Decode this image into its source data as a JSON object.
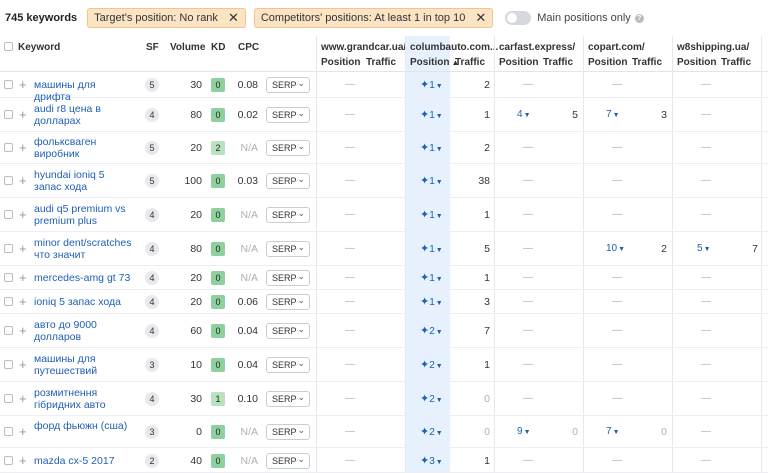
{
  "toolbar": {
    "keyword_count": "745 keywords",
    "filter_target": "Target's position: No rank",
    "filter_competitors": "Competitors' positions: At least 1 in top 10",
    "main_positions_label": "Main positions only",
    "close_glyph": "✕",
    "info_glyph": "?"
  },
  "headers": {
    "keyword": "Keyword",
    "sf": "SF",
    "volume": "Volume",
    "kd": "KD",
    "cpc": "CPC",
    "position": "Position",
    "traffic": "Traffic",
    "sort_arrow": "▲",
    "competitors": [
      "www.grandcar.ua/",
      "columbauto.com...",
      "carfast.express/",
      "copart.com/",
      "w8shipping.ua/"
    ]
  },
  "colors": {
    "kd_green": "#8fd19e",
    "kd_lightgreen": "#b9e2bf",
    "link": "#1f5fb4",
    "chip_bg": "#fbe3c4",
    "highlight_col": "#e6f1fd"
  },
  "rows": [
    {
      "kw": "машины для дрифта",
      "sf": "5",
      "vol": "30",
      "kd": "0",
      "cpc": "0.08",
      "serp": "SERP",
      "c1": "—",
      "c2_pos": "1",
      "c2_tr": "2",
      "c3_pos": "—",
      "c3_tr": "",
      "c4_pos": "—",
      "c4_tr": "",
      "c5_pos": "—",
      "c5_tr": ""
    },
    {
      "kw": "audi r8 цена в долларах",
      "sf": "4",
      "vol": "80",
      "kd": "0",
      "cpc": "0.02",
      "serp": "SERP",
      "c1": "—",
      "c2_pos": "1",
      "c2_tr": "1",
      "c3_pos": "4",
      "c3_tr": "5",
      "c4_pos": "7",
      "c4_tr": "3",
      "c5_pos": "—",
      "c5_tr": ""
    },
    {
      "kw": "фольксваген виробник",
      "sf": "5",
      "vol": "20",
      "kd": "2",
      "cpc": "N/A",
      "serp": "SERP",
      "c1": "—",
      "c2_pos": "1",
      "c2_tr": "2",
      "c3_pos": "—",
      "c3_tr": "",
      "c4_pos": "—",
      "c4_tr": "",
      "c5_pos": "—",
      "c5_tr": ""
    },
    {
      "kw": "hyundai ioniq 5 запас хода",
      "sf": "5",
      "vol": "100",
      "kd": "0",
      "cpc": "0.03",
      "serp": "SERP",
      "c1": "—",
      "c2_pos": "1",
      "c2_tr": "38",
      "c3_pos": "—",
      "c3_tr": "",
      "c4_pos": "—",
      "c4_tr": "",
      "c5_pos": "—",
      "c5_tr": ""
    },
    {
      "kw": "audi q5 premium vs premium plus",
      "sf": "4",
      "vol": "20",
      "kd": "0",
      "cpc": "N/A",
      "serp": "SERP",
      "c1": "—",
      "c2_pos": "1",
      "c2_tr": "1",
      "c3_pos": "—",
      "c3_tr": "",
      "c4_pos": "—",
      "c4_tr": "",
      "c5_pos": "—",
      "c5_tr": ""
    },
    {
      "kw": "minor dent/scratches что значит",
      "sf": "4",
      "vol": "80",
      "kd": "0",
      "cpc": "N/A",
      "serp": "SERP",
      "c1": "—",
      "c2_pos": "1",
      "c2_tr": "5",
      "c3_pos": "—",
      "c3_tr": "",
      "c4_pos": "10",
      "c4_tr": "2",
      "c5_pos": "5",
      "c5_tr": "7"
    },
    {
      "kw": "mercedes-amg gt 73",
      "sf": "4",
      "vol": "20",
      "kd": "0",
      "cpc": "N/A",
      "serp": "SERP",
      "c1": "—",
      "c2_pos": "1",
      "c2_tr": "1",
      "c3_pos": "—",
      "c3_tr": "",
      "c4_pos": "—",
      "c4_tr": "",
      "c5_pos": "—",
      "c5_tr": ""
    },
    {
      "kw": "ioniq 5 запас хода",
      "sf": "4",
      "vol": "20",
      "kd": "0",
      "cpc": "0.06",
      "serp": "SERP",
      "c1": "—",
      "c2_pos": "1",
      "c2_tr": "3",
      "c3_pos": "—",
      "c3_tr": "",
      "c4_pos": "—",
      "c4_tr": "",
      "c5_pos": "—",
      "c5_tr": ""
    },
    {
      "kw": "авто до 9000 долларов",
      "sf": "4",
      "vol": "60",
      "kd": "0",
      "cpc": "0.04",
      "serp": "SERP",
      "c1": "—",
      "c2_pos": "2",
      "c2_tr": "7",
      "c3_pos": "—",
      "c3_tr": "",
      "c4_pos": "—",
      "c4_tr": "",
      "c5_pos": "—",
      "c5_tr": ""
    },
    {
      "kw": "машины для путешествий",
      "sf": "3",
      "vol": "10",
      "kd": "0",
      "cpc": "0.04",
      "serp": "SERP",
      "c1": "—",
      "c2_pos": "2",
      "c2_tr": "1",
      "c3_pos": "—",
      "c3_tr": "",
      "c4_pos": "—",
      "c4_tr": "",
      "c5_pos": "—",
      "c5_tr": ""
    },
    {
      "kw": "розмитнення гібридних авто",
      "sf": "4",
      "vol": "30",
      "kd": "1",
      "cpc": "0.10",
      "serp": "SERP",
      "c1": "—",
      "c2_pos": "2",
      "c2_tr": "0",
      "c3_pos": "—",
      "c3_tr": "",
      "c4_pos": "—",
      "c4_tr": "",
      "c5_pos": "—",
      "c5_tr": ""
    },
    {
      "kw": "форд фьюжн (сша)",
      "sf": "3",
      "vol": "0",
      "kd": "0",
      "cpc": "N/A",
      "serp": "SERP",
      "c1": "—",
      "c2_pos": "2",
      "c2_tr": "0",
      "c3_pos": "9",
      "c3_tr": "0",
      "c4_pos": "7",
      "c4_tr": "0",
      "c5_pos": "—",
      "c5_tr": ""
    },
    {
      "kw": "mazda cx-5 2017",
      "sf": "2",
      "vol": "40",
      "kd": "0",
      "cpc": "N/A",
      "serp": "SERP",
      "c1": "—",
      "c2_pos": "3",
      "c2_tr": "1",
      "c3_pos": "—",
      "c3_tr": "",
      "c4_pos": "—",
      "c4_tr": "",
      "c5_pos": "—",
      "c5_tr": ""
    }
  ]
}
